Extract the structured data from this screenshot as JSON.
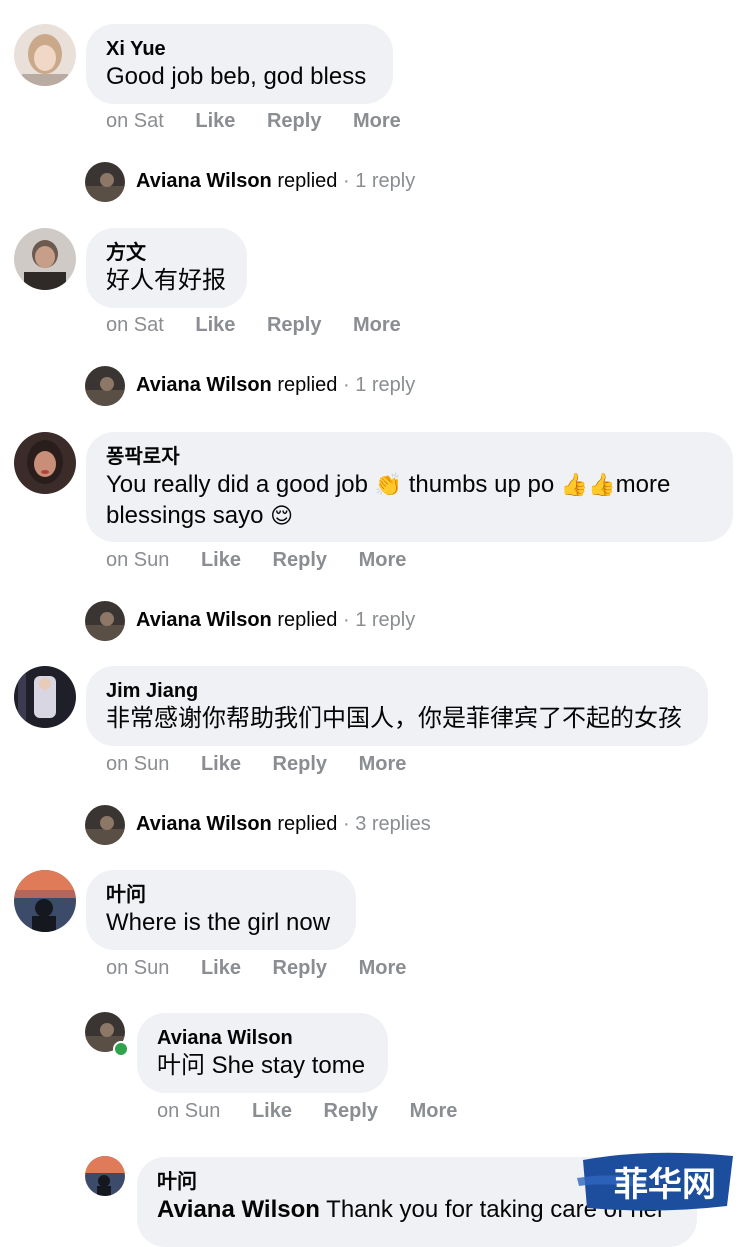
{
  "comments": [
    {
      "author": "Xi Yue",
      "text": "Good job beb, god bless",
      "time": "on Sat",
      "like": "Like",
      "reply": "Reply",
      "more": "More",
      "replied": {
        "name": "Aviana Wilson",
        "verb": "replied",
        "sep": "·",
        "count": "1 reply"
      }
    },
    {
      "author": "方文",
      "text": "好人有好报",
      "time": "on Sat",
      "like": "Like",
      "reply": "Reply",
      "more": "More",
      "replied": {
        "name": "Aviana Wilson",
        "verb": "replied",
        "sep": "·",
        "count": "1 reply"
      }
    },
    {
      "author": "퐁팍로자",
      "text_part1": "You really did a good job ",
      "emoji_clap": "👏",
      "text_part2": " thumbs up po ",
      "emoji_thumbs": "👍👍",
      "text_part3": "more",
      "text_line2": "blessings sayo ",
      "emoji_smile": "😌",
      "time": "on Sun",
      "like": "Like",
      "reply": "Reply",
      "more": "More",
      "replied": {
        "name": "Aviana Wilson",
        "verb": "replied",
        "sep": "·",
        "count": "1 reply"
      }
    },
    {
      "author": "Jim Jiang",
      "text": "非常感谢你帮助我们中国人，你是菲律宾了不起的女孩",
      "time": "on Sun",
      "like": "Like",
      "reply": "Reply",
      "more": "More",
      "replied": {
        "name": "Aviana Wilson",
        "verb": "replied",
        "sep": "·",
        "count": "3 replies"
      }
    },
    {
      "author": "叶问",
      "text": "Where is the girl now",
      "time": "on Sun",
      "like": "Like",
      "reply": "Reply",
      "more": "More"
    }
  ],
  "replies": [
    {
      "author": "Aviana Wilson",
      "mention": "叶问",
      "text": " She stay tome",
      "time": "on Sun",
      "like": "Like",
      "reply": "Reply",
      "more": "More"
    },
    {
      "author": "叶问",
      "mention": "Aviana Wilson",
      "text": " Thank you for taking care of her"
    }
  ],
  "watermark": "菲华网",
  "colors": {
    "bubble": "#eff1f4",
    "meta": "#8a8d91",
    "online": "#31a24c",
    "watermark": "#1d4e9e"
  }
}
